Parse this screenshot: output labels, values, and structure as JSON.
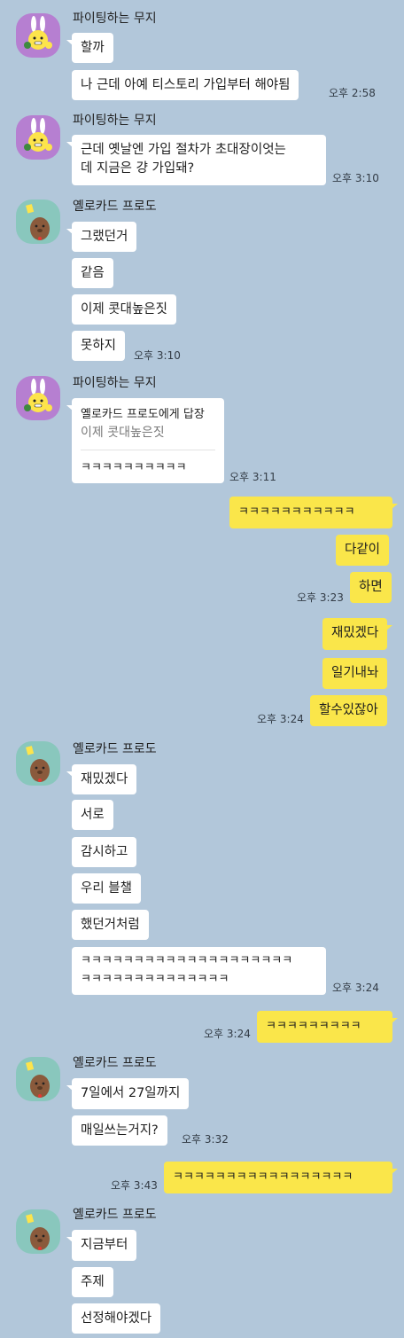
{
  "senders": {
    "muzi": "파이팅하는 무지",
    "frodo": "옐로카드 프로도"
  },
  "messages": {
    "m1": "할까",
    "m2": "나 근데 아예 티스토리 가입부터 해야됨",
    "t2": "오후 2:58",
    "m3a": "근데 옛날엔 가입 절차가 초대장이엇는",
    "m3b": "데 지금은 걍 가입돼?",
    "t3": "오후 3:10",
    "f1": "그랬던거",
    "f2": "같음",
    "f3": "이제 콧대높은짓",
    "f4": "못하지",
    "tf4": "오후 3:10",
    "reply_to": "옐로카드 프로도에게 답장",
    "reply_quote": "이제 콧대높은짓",
    "reply_text": "ㅋㅋㅋㅋㅋㅋㅋㅋㅋㅋ",
    "t_reply": "오후 3:11",
    "o1": "ㅋㅋㅋㅋㅋㅋㅋㅋㅋㅋㅋ",
    "o2": "다같이",
    "o3": "하면",
    "to3": "오후 3:23",
    "o4": "재밌겠다",
    "o5": "일기내놔",
    "o6": "할수있잖아",
    "to6": "오후 3:24",
    "g1": "재밌겠다",
    "g2": "서로",
    "g3": "감시하고",
    "g4": "우리 블챌",
    "g5": "했던거처럼",
    "g6a": "ㅋㅋㅋㅋㅋㅋㅋㅋㅋㅋㅋㅋㅋㅋㅋㅋㅋㅋㅋㅋ",
    "g6b": "ㅋㅋㅋㅋㅋㅋㅋㅋㅋㅋㅋㅋㅋㅋ",
    "tg6": "오후 3:24",
    "o7": "ㅋㅋㅋㅋㅋㅋㅋㅋㅋ",
    "to7": "오후 3:24",
    "h1": "7일에서 27일까지",
    "h2": "매일쓰는거지?",
    "th2": "오후 3:32",
    "o8": "ㅋㅋㅋㅋㅋㅋㅋㅋㅋㅋㅋㅋㅋㅋㅋㅋㅋ",
    "to8": "오후 3:43",
    "k1": "지금부터",
    "k2": "주제",
    "k3": "선정해야겠다"
  },
  "colors": {
    "background": "#b2c7da",
    "incoming_bubble": "#ffffff",
    "outgoing_bubble": "#fae64a",
    "muzi_avatar": "#b67fd1",
    "frodo_avatar": "#89c7bd"
  },
  "icons": {
    "muzi_avatar": "muzi-character-icon",
    "frodo_avatar": "frodo-character-icon"
  }
}
